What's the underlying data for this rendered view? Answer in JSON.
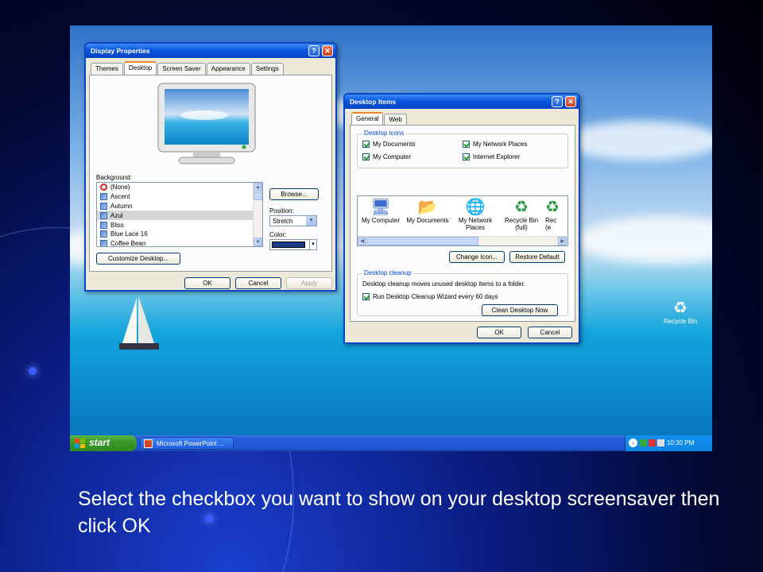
{
  "display_properties": {
    "title": "Display Properties",
    "help_btn": "?",
    "close_btn": "✕",
    "tabs": [
      "Themes",
      "Desktop",
      "Screen Saver",
      "Appearance",
      "Settings"
    ],
    "active_tab": "Desktop",
    "background_label": "Background:",
    "background_items": [
      "(None)",
      "Ascent",
      "Autumn",
      "Azul",
      "Bliss",
      "Blue Lace 16",
      "Coffee Bean"
    ],
    "selected_background": "Azul",
    "browse_button": "Browse...",
    "position_label": "Position:",
    "position_value": "Stretch",
    "color_label": "Color:",
    "color_value": "#1a3c8c",
    "customize_button": "Customize Desktop...",
    "ok_button": "OK",
    "cancel_button": "Cancel",
    "apply_button": "Apply"
  },
  "desktop_items": {
    "title": "Desktop Items",
    "help_btn": "?",
    "close_btn": "✕",
    "tabs": [
      "General",
      "Web"
    ],
    "active_tab": "General",
    "desktop_icons_legend": "Desktop icons",
    "checkboxes": {
      "my_documents": {
        "label": "My Documents",
        "checked": true
      },
      "my_network_places": {
        "label": "My Network Places",
        "checked": true
      },
      "my_computer": {
        "label": "My Computer",
        "checked": true
      },
      "internet_explorer": {
        "label": "Internet Explorer",
        "checked": true
      }
    },
    "icon_previews": [
      {
        "label": "My Computer",
        "icon": "computer-icon"
      },
      {
        "label": "My Documents",
        "icon": "folder-icon"
      },
      {
        "label": "My Network\nPlaces",
        "icon": "network-icon"
      },
      {
        "label": "Recycle Bin\n(full)",
        "icon": "recycle-bin-full-icon"
      },
      {
        "label": "Rec\n(e",
        "icon": "recycle-bin-empty-icon"
      }
    ],
    "change_icon_button": "Change Icon...",
    "restore_default_button": "Restore Default",
    "cleanup_legend": "Desktop cleanup",
    "cleanup_text": "Desktop cleanup moves unused desktop items to a folder.",
    "cleanup_checkbox": {
      "label": "Run Desktop Cleanup Wizard every 60 days",
      "checked": true
    },
    "clean_now_button": "Clean Desktop Now",
    "ok_button": "OK",
    "cancel_button": "Cancel"
  },
  "desktop": {
    "recycle_bin_label": "Recycle Bin"
  },
  "taskbar": {
    "start_label": "start",
    "task_label": "Microsoft PowerPoint ...",
    "clock": "10:30 PM"
  },
  "caption": "Select the checkbox you want to show on your desktop screensaver then click OK"
}
